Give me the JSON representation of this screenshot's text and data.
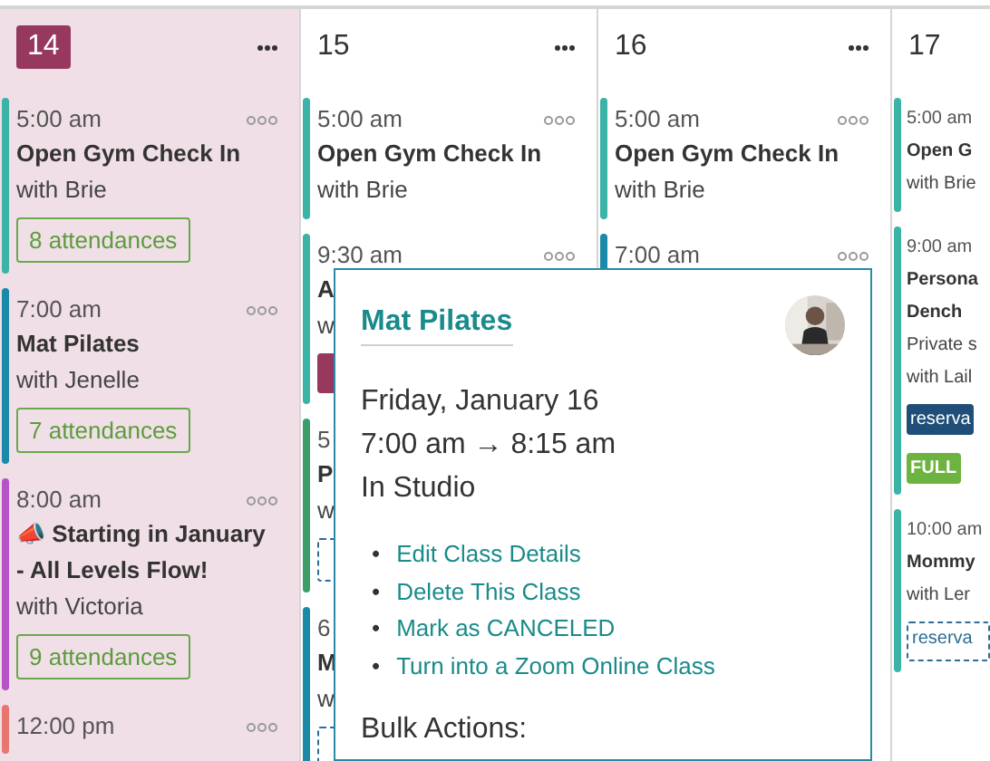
{
  "days": [
    {
      "number": "14",
      "selected": true,
      "menu": true,
      "events": [
        {
          "time": "5:00 am",
          "title": "Open Gym Check In",
          "instructor": "with Brie",
          "menu": true,
          "color": "#3bb3a6",
          "badges": [
            {
              "kind": "attendance",
              "text": "8 attendances"
            }
          ]
        },
        {
          "time": "7:00 am",
          "title": "Mat Pilates",
          "instructor": "with Jenelle",
          "menu": true,
          "color": "#1a8aa8",
          "badges": [
            {
              "kind": "attendance",
              "text": "7 attendances"
            }
          ]
        },
        {
          "time": "8:00 am",
          "title": "📣 Starting in January - All Levels Flow!",
          "instructor": "with Victoria",
          "menu": true,
          "color": "#b554c8",
          "badges": [
            {
              "kind": "attendance",
              "text": "9 attendances"
            }
          ]
        },
        {
          "time": "12:00 pm",
          "menu": true,
          "color": "#e8766e"
        }
      ]
    },
    {
      "number": "15",
      "selected": false,
      "menu": true,
      "events": [
        {
          "time": "5:00 am",
          "title": "Open Gym Check In",
          "instructor": "with Brie",
          "menu": true,
          "color": "#3bb3a6"
        },
        {
          "time": "9:30 am",
          "title": "A",
          "instructor": "w",
          "menu": true,
          "color": "#3bb3a6",
          "badges": [
            {
              "kind": "block"
            }
          ]
        },
        {
          "time": "5",
          "title": "P",
          "instructor": "w",
          "menu": false,
          "color": "#3e9e6a",
          "badges": [
            {
              "kind": "dashed"
            }
          ]
        },
        {
          "time": "6",
          "title": "M",
          "instructor": "w",
          "menu": false,
          "color": "#1a8aa8",
          "badges": [
            {
              "kind": "dashed"
            }
          ]
        }
      ]
    },
    {
      "number": "16",
      "selected": false,
      "menu": true,
      "events": [
        {
          "time": "5:00 am",
          "title": "Open Gym Check In",
          "instructor": "with Brie",
          "menu": true,
          "color": "#3bb3a6"
        },
        {
          "time": "7:00 am",
          "menu": true,
          "color": "#1a8aa8"
        }
      ]
    },
    {
      "number": "17",
      "selected": false,
      "menu": false,
      "events": [
        {
          "time": "5:00 am",
          "title": "Open G",
          "instructor": "with Brie",
          "menu": false,
          "color": "#3bb3a6"
        },
        {
          "time": "9:00 am",
          "title": "Persona",
          "title2": "Dench",
          "note": "Private s",
          "instructor": "with Lail",
          "menu": false,
          "color": "#3bb3a6",
          "badges": [
            {
              "kind": "reservation",
              "text": "reserva"
            },
            {
              "kind": "full",
              "text": "FULL"
            }
          ]
        },
        {
          "time": "10:00 am",
          "title": "Mommy",
          "instructor": "with Ler",
          "menu": false,
          "color": "#3bb3a6",
          "badges": [
            {
              "kind": "dashed",
              "text": "reserva"
            }
          ]
        }
      ]
    }
  ],
  "popover": {
    "title": "Mat Pilates",
    "date": "Friday, January 16",
    "time": "7:00 am → 8:15 am",
    "location": "In Studio",
    "actions": [
      {
        "bullet": "•",
        "label": "Edit Class Details"
      },
      {
        "bullet": "•",
        "label": "Delete This Class"
      },
      {
        "bullet": "•",
        "label": "Mark as CANCELED"
      },
      {
        "bullet": "•",
        "label": "Turn into a Zoom Online Class"
      }
    ],
    "bulk_label": "Bulk Actions:"
  }
}
